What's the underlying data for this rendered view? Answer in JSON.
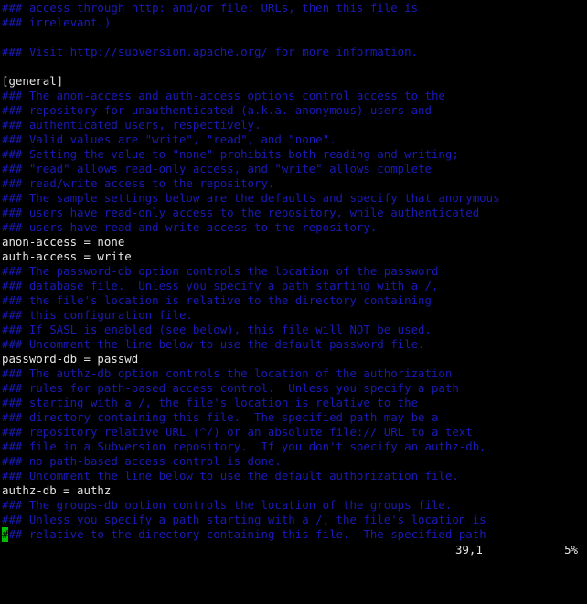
{
  "editor": {
    "lines": [
      {
        "text": "### access through http: and/or file: URLs, then this file is",
        "kind": "comment"
      },
      {
        "text": "### irrelevant.)",
        "kind": "comment"
      },
      {
        "text": "",
        "kind": "code"
      },
      {
        "text": "### Visit http://subversion.apache.org/ for more information.",
        "kind": "comment"
      },
      {
        "text": "",
        "kind": "code"
      },
      {
        "text": "[general]",
        "kind": "code"
      },
      {
        "text": "### The anon-access and auth-access options control access to the",
        "kind": "comment"
      },
      {
        "text": "### repository for unauthenticated (a.k.a. anonymous) users and",
        "kind": "comment"
      },
      {
        "text": "### authenticated users, respectively.",
        "kind": "comment"
      },
      {
        "text": "### Valid values are \"write\", \"read\", and \"none\".",
        "kind": "comment"
      },
      {
        "text": "### Setting the value to \"none\" prohibits both reading and writing;",
        "kind": "comment"
      },
      {
        "text": "### \"read\" allows read-only access, and \"write\" allows complete",
        "kind": "comment"
      },
      {
        "text": "### read/write access to the repository.",
        "kind": "comment"
      },
      {
        "text": "### The sample settings below are the defaults and specify that anonymous",
        "kind": "comment"
      },
      {
        "text": "### users have read-only access to the repository, while authenticated",
        "kind": "comment"
      },
      {
        "text": "### users have read and write access to the repository.",
        "kind": "comment"
      },
      {
        "text": "anon-access = none",
        "kind": "code"
      },
      {
        "text": "auth-access = write",
        "kind": "code"
      },
      {
        "text": "### The password-db option controls the location of the password",
        "kind": "comment"
      },
      {
        "text": "### database file.  Unless you specify a path starting with a /,",
        "kind": "comment"
      },
      {
        "text": "### the file's location is relative to the directory containing",
        "kind": "comment"
      },
      {
        "text": "### this configuration file.",
        "kind": "comment"
      },
      {
        "text": "### If SASL is enabled (see below), this file will NOT be used.",
        "kind": "comment"
      },
      {
        "text": "### Uncomment the line below to use the default password file.",
        "kind": "comment"
      },
      {
        "text": "password-db = passwd",
        "kind": "code"
      },
      {
        "text": "### The authz-db option controls the location of the authorization",
        "kind": "comment"
      },
      {
        "text": "### rules for path-based access control.  Unless you specify a path",
        "kind": "comment"
      },
      {
        "text": "### starting with a /, the file's location is relative to the",
        "kind": "comment"
      },
      {
        "text": "### directory containing this file.  The specified path may be a",
        "kind": "comment"
      },
      {
        "text": "### repository relative URL (^/) or an absolute file:// URL to a text",
        "kind": "comment"
      },
      {
        "text": "### file in a Subversion repository.  If you don't specify an authz-db,",
        "kind": "comment"
      },
      {
        "text": "### no path-based access control is done.",
        "kind": "comment"
      },
      {
        "text": "### Uncomment the line below to use the default authorization file.",
        "kind": "comment"
      },
      {
        "text": "authz-db = authz",
        "kind": "code"
      },
      {
        "text": "### The groups-db option controls the location of the groups file.",
        "kind": "comment"
      },
      {
        "text": "### Unless you specify a path starting with a /, the file's location is",
        "kind": "comment"
      }
    ],
    "cursor_line": {
      "cursor_char": "#",
      "rest": "## relative to the directory containing this file.  The specified path",
      "kind": "comment"
    }
  },
  "status": {
    "cursor_position": "39,1",
    "scroll_percent": "5%"
  },
  "colors": {
    "background": "#000000",
    "comment": "#1a1ab8",
    "text": "#e6e6e6",
    "cursor": "#00c000"
  }
}
